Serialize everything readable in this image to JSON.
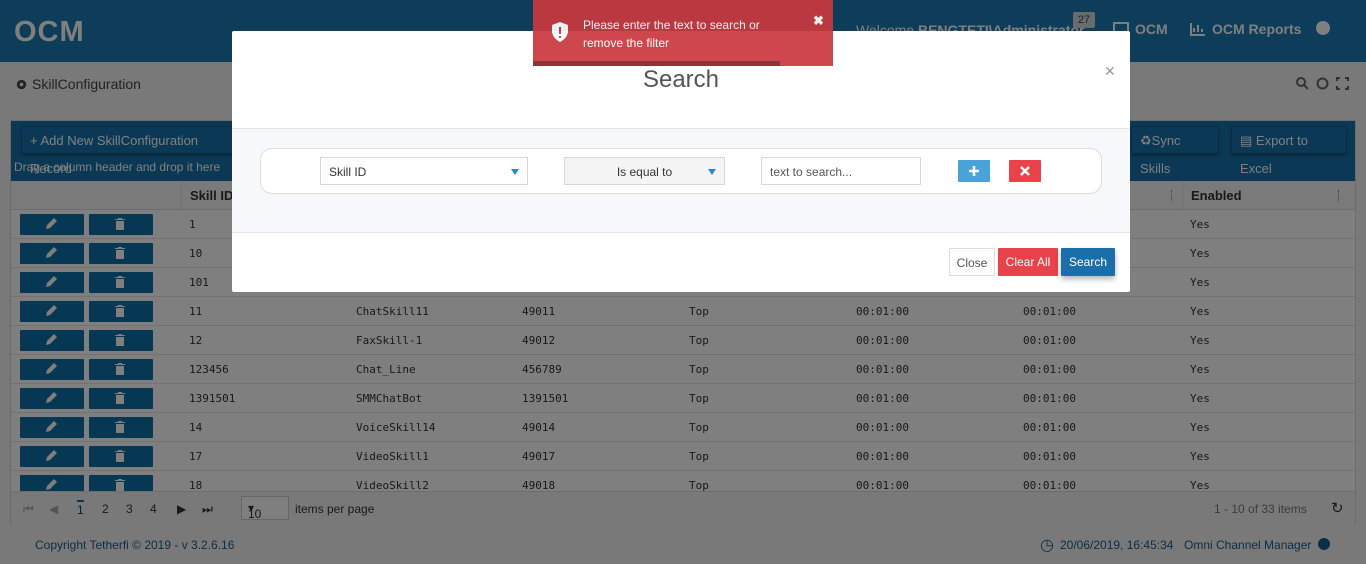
{
  "header": {
    "logo": "OCM",
    "welcome_prefix": "Welcome ",
    "welcome_user": "BENGTETI\\Administrator",
    "notif_count": "27",
    "nav_ocm": "OCM",
    "nav_reports": "OCM Reports"
  },
  "page": {
    "title": "SkillConfiguration"
  },
  "toolbar": {
    "add_label": "Add New SkillConfiguration Record",
    "sync_label": "Sync Skills",
    "export_label": "Export to Excel",
    "group_hint": "Drag a column header and drop it here"
  },
  "grid": {
    "headers": [
      "Skill ID",
      "Enabled"
    ],
    "rows": [
      {
        "skill_id": "1",
        "name": "",
        "vdn": "",
        "type": "",
        "t1": "",
        "t2": "",
        "enabled": "Yes"
      },
      {
        "skill_id": "10",
        "name": "",
        "vdn": "",
        "type": "",
        "t1": "",
        "t2": "",
        "enabled": "Yes"
      },
      {
        "skill_id": "101",
        "name": "",
        "vdn": "",
        "type": "",
        "t1": "",
        "t2": "",
        "enabled": "Yes"
      },
      {
        "skill_id": "11",
        "name": "ChatSkill11",
        "vdn": "49011",
        "type": "Top",
        "t1": "00:01:00",
        "t2": "00:01:00",
        "enabled": "Yes"
      },
      {
        "skill_id": "12",
        "name": "FaxSkill-1",
        "vdn": "49012",
        "type": "Top",
        "t1": "00:01:00",
        "t2": "00:01:00",
        "enabled": "Yes"
      },
      {
        "skill_id": "123456",
        "name": "Chat_Line",
        "vdn": "456789",
        "type": "Top",
        "t1": "00:01:00",
        "t2": "00:01:00",
        "enabled": "Yes"
      },
      {
        "skill_id": "1391501",
        "name": "SMMChatBot",
        "vdn": "1391501",
        "type": "Top",
        "t1": "00:01:00",
        "t2": "00:01:00",
        "enabled": "Yes"
      },
      {
        "skill_id": "14",
        "name": "VoiceSkill14",
        "vdn": "49014",
        "type": "Top",
        "t1": "00:01:00",
        "t2": "00:01:00",
        "enabled": "Yes"
      },
      {
        "skill_id": "17",
        "name": "VideoSkill1",
        "vdn": "49017",
        "type": "Top",
        "t1": "00:01:00",
        "t2": "00:01:00",
        "enabled": "Yes"
      },
      {
        "skill_id": "18",
        "name": "VideoSkill2",
        "vdn": "49018",
        "type": "Top",
        "t1": "00:01:00",
        "t2": "00:01:00",
        "enabled": "Yes"
      }
    ]
  },
  "pager": {
    "pages": [
      "1",
      "2",
      "3",
      "4"
    ],
    "current_page": "1",
    "page_size": "10",
    "per_page_label": "items per page",
    "info": "1 - 10 of 33 items"
  },
  "footer": {
    "copyright": "Copyright Tetherfi © 2019 - v 3.2.6.16",
    "datetime": "20/06/2019, 16:45:34",
    "app_name": "Omni Channel Manager"
  },
  "modal": {
    "title": "Search",
    "field_value": "Skill ID",
    "operator_value": "Is equal to",
    "search_placeholder": "text to search...",
    "close_label": "Close",
    "clear_label": "Clear All",
    "search_label": "Search"
  },
  "toast": {
    "message": "Please enter the text to search or remove the filter"
  },
  "colors": {
    "brand": "#1d7bb5",
    "toolbar": "#1673ab",
    "danger": "#e8424a",
    "toast": "#c9383d",
    "primary_button": "#1a6fab"
  }
}
